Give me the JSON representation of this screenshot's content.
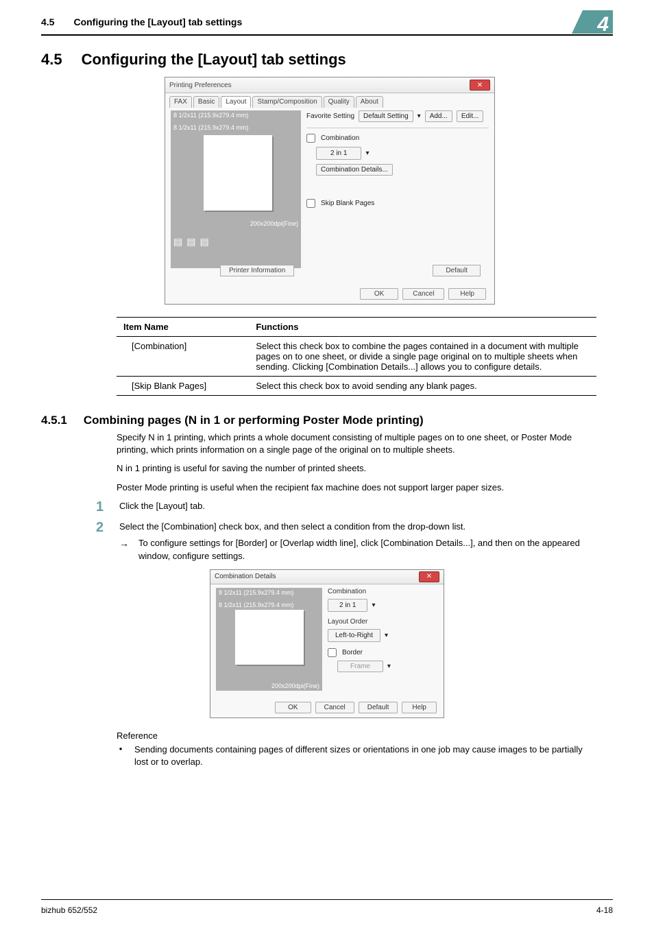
{
  "header": {
    "section_no": "4.5",
    "section_title_running": "Configuring the [Layout] tab settings",
    "chapter_number": "4"
  },
  "h2": {
    "number": "4.5",
    "title": "Configuring the [Layout] tab settings"
  },
  "printing_prefs_fig": {
    "window_title": "Printing Preferences",
    "close_x": "✕",
    "tabs": [
      "FAX",
      "Basic",
      "Layout",
      "Stamp/Composition",
      "Quality",
      "About"
    ],
    "active_tab": "Layout",
    "paper1": "8 1/2x11 (215.9x279.4 mm)",
    "paper2": "8 1/2x11 (215.9x279.4 mm)",
    "dpi": "200x200dpi(Fine)",
    "favorite_label": "Favorite Setting",
    "favorite_value": "Default Setting",
    "add_btn": "Add...",
    "edit_btn": "Edit...",
    "combination_chk": "Combination",
    "combination_value": "2 in 1",
    "combination_details_btn": "Combination Details...",
    "skip_blank_chk": "Skip Blank Pages",
    "printer_info_btn": "Printer Information",
    "default_btn": "Default",
    "ok": "OK",
    "cancel": "Cancel",
    "help": "Help"
  },
  "functions_table": {
    "head_item": "Item Name",
    "head_func": "Functions",
    "rows": [
      {
        "item": "[Combination]",
        "func": "Select this check box to combine the pages contained in a document with multiple pages on to one sheet, or divide a single page original on to multiple sheets when sending. Clicking [Combination Details...] allows you to configure details."
      },
      {
        "item": "[Skip Blank Pages]",
        "func": "Select this check box to avoid sending any blank pages."
      }
    ]
  },
  "h3": {
    "number": "4.5.1",
    "title": "Combining pages (N in 1 or performing Poster Mode printing)"
  },
  "body_paras": [
    "Specify N in 1 printing, which prints a whole document consisting of multiple pages on to one sheet, or Poster Mode printing, which prints information on a single page of the original on to multiple sheets.",
    "N in 1 printing is useful for saving the number of printed sheets.",
    "Poster Mode printing is useful when the recipient fax machine does not support larger paper sizes."
  ],
  "steps": [
    {
      "num": "1",
      "text": "Click the [Layout] tab.",
      "subs": []
    },
    {
      "num": "2",
      "text": "Select the [Combination] check box, and then select a condition from the drop-down list.",
      "subs": [
        {
          "arrow": "→",
          "text": "To configure settings for [Border] or [Overlap width line], click [Combination Details...], and then on the appeared window, configure settings."
        }
      ]
    }
  ],
  "combo_fig": {
    "window_title": "Combination Details",
    "close_x": "✕",
    "paper1": "8 1/2x11 (215.9x279.4 mm)",
    "paper2": "8 1/2x11 (215.9x279.4 mm)",
    "dpi": "200x200dpi(Fine)",
    "combination_label": "Combination",
    "combination_value": "2 in 1",
    "layout_order_label": "Layout Order",
    "layout_order_value": "Left-to-Right",
    "border_chk": "Border",
    "border_value": "Frame",
    "ok": "OK",
    "cancel": "Cancel",
    "default": "Default",
    "help": "Help"
  },
  "reference": {
    "title": "Reference",
    "bullet": "Sending documents containing pages of different sizes or orientations in one job may cause images to be partially lost or to overlap."
  },
  "footer": {
    "product": "bizhub 652/552",
    "page": "4-18"
  }
}
